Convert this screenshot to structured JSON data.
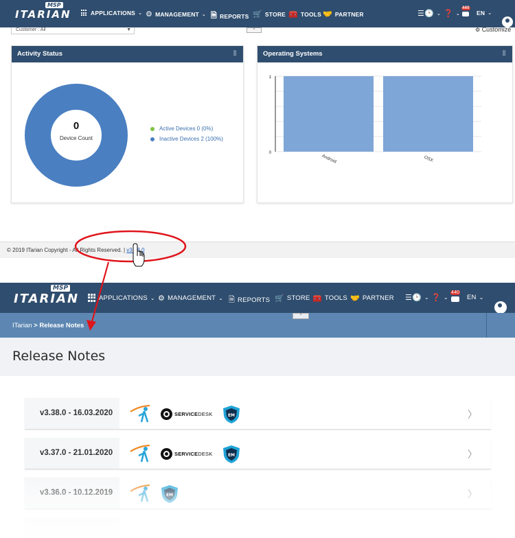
{
  "brand": {
    "name": "ITARIAN",
    "badge": "MSP"
  },
  "nav": {
    "applications": "APPLICATIONS",
    "management": "MANAGEMENT",
    "reports": "REPORTS",
    "store": "STORE",
    "tools": "TOOLS",
    "partner": "PARTNER",
    "notification_count": "440",
    "language": "EN"
  },
  "dashboard": {
    "customer_filter": "Customer : All",
    "customize": "Customize",
    "activity": {
      "title": "Activity Status",
      "center_value": "0",
      "center_label": "Device Count",
      "legend": [
        {
          "label": "Active Devices 0 (0%)",
          "color": "#7dc242"
        },
        {
          "label": "Inactive Devices 2 (100%)",
          "color": "#4a7fc1"
        }
      ]
    },
    "os": {
      "title": "Operating Systems"
    }
  },
  "footer": {
    "copyright": "© 2019 ITarian Copyright - All Rights Reserved.",
    "separator": "|",
    "version": "v3.38.0"
  },
  "breadcrumb": {
    "root": "ITarian",
    "current": "Release Notes",
    "sep": ">"
  },
  "page": {
    "title": "Release Notes"
  },
  "service_desk": {
    "bold": "SERVICE",
    "rest": "DESK"
  },
  "release_notes": [
    {
      "version": "v3.38.0 - 16.03.2020"
    },
    {
      "version": "v3.37.0 - 21.01.2020"
    },
    {
      "version": "v3.36.0 - 10.12.2019"
    }
  ],
  "chart_data": {
    "type": "bar",
    "categories": [
      "Android",
      "OSX"
    ],
    "values": [
      1,
      1
    ],
    "ylim": [
      0,
      1
    ],
    "yticks": [
      "0",
      "1"
    ],
    "color": "#7ea6d6",
    "grid": true
  },
  "colors": {
    "navbar": "#2f4d6e",
    "breadcrumb_band": "#5d87b2",
    "donut": "#4a7fc1",
    "annotation": "#e0141b"
  }
}
